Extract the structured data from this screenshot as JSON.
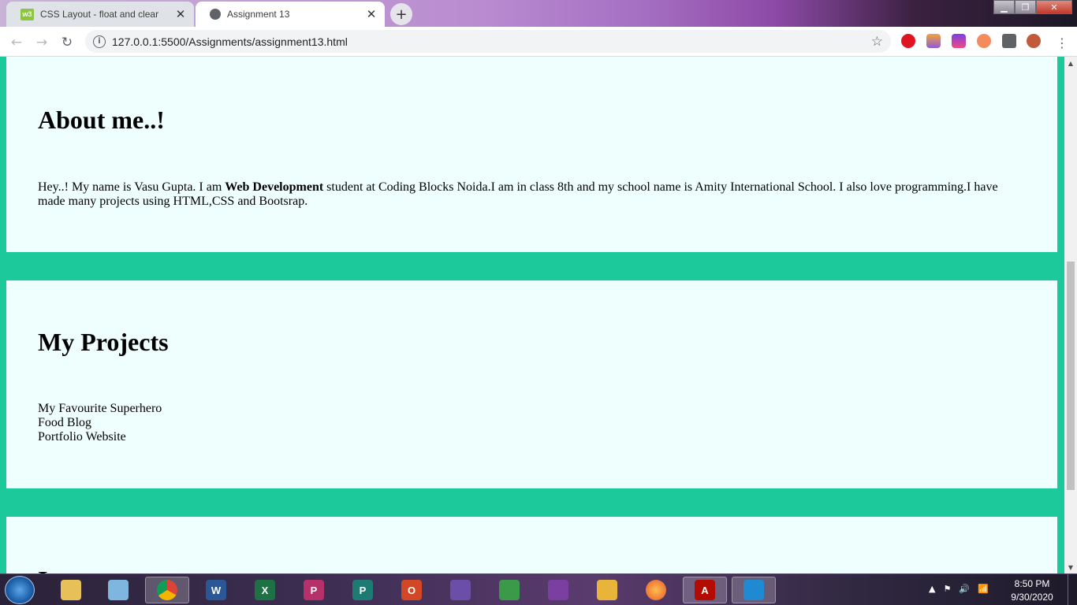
{
  "browser": {
    "tabs": [
      {
        "title": "CSS Layout - float and clear",
        "favicon": "w3schools-icon",
        "active": false
      },
      {
        "title": "Assignment 13",
        "favicon": "globe-icon",
        "active": true
      }
    ],
    "url": "127.0.0.1:5500/Assignments/assignment13.html"
  },
  "page": {
    "about": {
      "heading": "About me..!",
      "text_before": "Hey..! My name is Vasu Gupta. I am ",
      "text_bold": "Web Development",
      "text_after": " student at Coding Blocks Noida.I am in class 8th and my school name is Amity International School. I also love programming.I have made many projects using HTML,CSS and Bootsrap."
    },
    "projects": {
      "heading": "My Projects",
      "items": [
        "My Favourite Superhero",
        "Food Blog",
        "Portfolio Website"
      ]
    },
    "third": {
      "heading": "I"
    }
  },
  "colors": {
    "page_background": "#1cc99a",
    "section_background": "#eefffe"
  },
  "taskbar": {
    "apps": [
      "start-orb",
      "file-explorer-icon",
      "notepad-icon",
      "chrome-icon",
      "word-icon",
      "excel-icon",
      "powerpoint-icon",
      "publisher-icon",
      "access-icon",
      "onenote-icon",
      "sync-icon",
      "infopath-icon",
      "outlook-icon",
      "firefox-icon",
      "acrobat-icon",
      "vscode-icon"
    ],
    "time": "8:50 PM",
    "date": "9/30/2020"
  }
}
